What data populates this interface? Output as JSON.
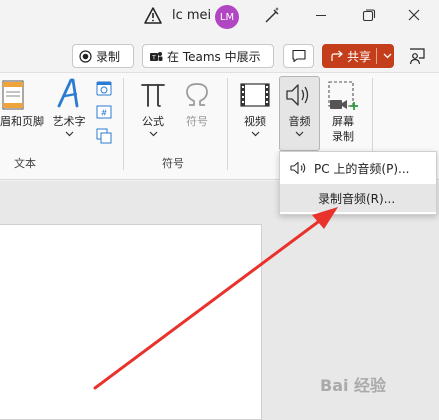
{
  "titlebar": {
    "warning_icon": "warning-icon",
    "user_name": "lc mei",
    "avatar_initials": "LM",
    "avatar_color": "#b146c2"
  },
  "commands": {
    "record_label": "录制",
    "teams_label": "在 Teams 中展示",
    "share_label": "共享",
    "share_color": "#c43e1c"
  },
  "ribbon": {
    "header_footer_label": "眉和页脚",
    "wordart_label": "艺术字",
    "equation_label": "公式",
    "symbol_label": "符号",
    "video_label": "视频",
    "audio_label": "音频",
    "screen_record_line1": "屏幕",
    "screen_record_line2": "录制",
    "group_text": "文本",
    "group_symbols": "符号"
  },
  "audio_menu": {
    "items": [
      {
        "label": "PC 上的音频(P)..."
      },
      {
        "label": "录制音频(R)..."
      }
    ]
  },
  "watermark": "Bai 经验",
  "annotation": {
    "arrow_color": "#e8322b"
  }
}
